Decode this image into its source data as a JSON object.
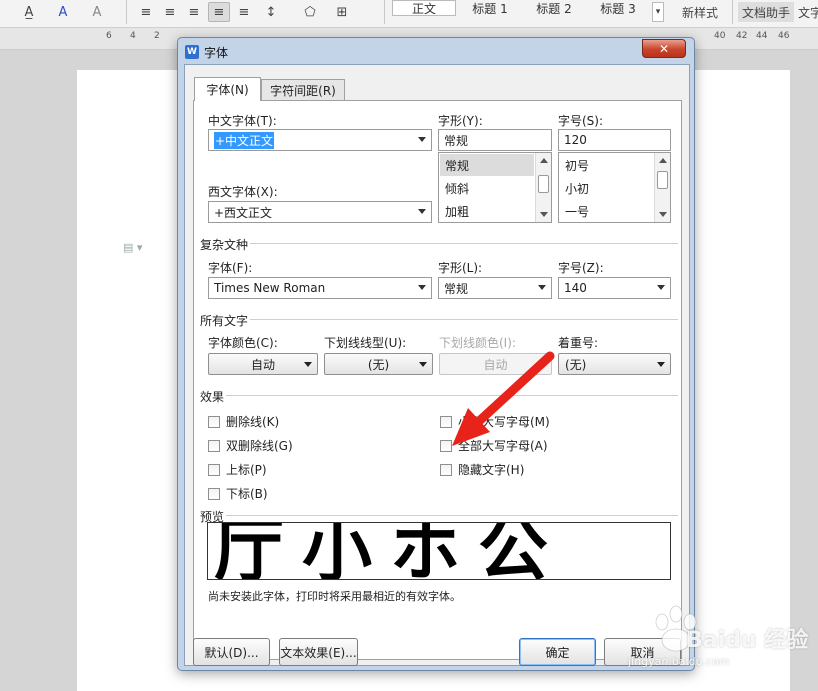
{
  "toolbar": {
    "style_gallery": [
      "正文",
      "标题 1",
      "标题 2",
      "标题 3"
    ],
    "new_style_label": "新样式",
    "doc_assistant_label": "文档助手",
    "truncated_label": "文字"
  },
  "ruler": {
    "ticks": [
      "6",
      "4",
      "2",
      "2",
      "4",
      "6",
      "8",
      "40",
      "42",
      "44",
      "46"
    ]
  },
  "dialog": {
    "title": "字体",
    "close_symbol": "✕",
    "tabs": [
      {
        "label": "字体(N)"
      },
      {
        "label": "字符间距(R)"
      }
    ],
    "chinese_font": {
      "label": "中文字体(T):",
      "value": "+中文正文"
    },
    "style": {
      "label": "字形(Y):",
      "value": "常规",
      "options": [
        "常规",
        "倾斜",
        "加粗"
      ]
    },
    "size": {
      "label": "字号(S):",
      "value": "120",
      "options": [
        "初号",
        "小初",
        "一号"
      ]
    },
    "western_font": {
      "label": "西文字体(X):",
      "value": "+西文正文"
    },
    "complex_section": "复杂文种",
    "complex_font": {
      "label": "字体(F):",
      "value": "Times New Roman"
    },
    "complex_style": {
      "label": "字形(L):",
      "value": "常规"
    },
    "complex_size": {
      "label": "字号(Z):",
      "value": "140"
    },
    "all_text_section": "所有文字",
    "font_color": {
      "label": "字体颜色(C):",
      "value": "自动"
    },
    "underline_type": {
      "label": "下划线线型(U):",
      "value": "(无)"
    },
    "underline_color": {
      "label": "下划线颜色(I):",
      "value": "自动"
    },
    "emphasis": {
      "label": "着重号:",
      "value": "(无)"
    },
    "effects_section": "效果",
    "effects": {
      "strikethrough": "删除线(K)",
      "double_strikethrough": "双删除线(G)",
      "superscript": "上标(P)",
      "subscript": "下标(B)",
      "small_caps": "小型大写字母(M)",
      "all_caps": "全部大写字母(A)",
      "hidden": "隐藏文字(H)"
    },
    "preview_section": "预览",
    "preview_text": "厅小ホ公",
    "note": "尚未安装此字体，打印时将采用最相近的有效字体。",
    "buttons": {
      "default": "默认(D)...",
      "text_effects": "文本效果(E)...",
      "ok": "确定",
      "cancel": "取消"
    }
  },
  "watermark": {
    "brand": "Baidu 经验",
    "url": "jingyan.baidu.com"
  },
  "colors": {
    "accent_arrow": "#e8231a",
    "selection": "#3399ff"
  }
}
